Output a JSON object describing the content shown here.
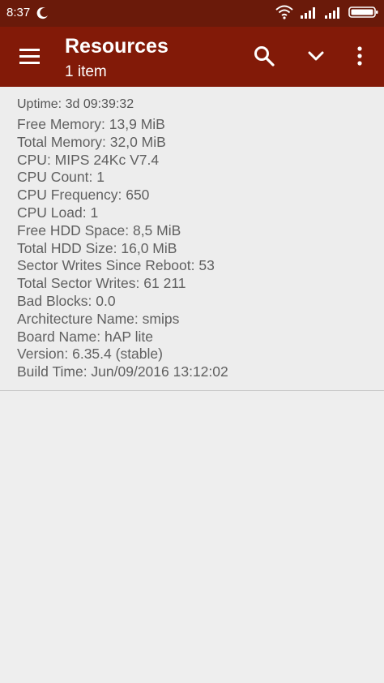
{
  "status_bar": {
    "time": "8:37",
    "app_icon": "moon-icon",
    "icons": [
      "wifi-icon",
      "signal-icon",
      "signal-icon",
      "battery-icon"
    ]
  },
  "toolbar": {
    "title": "Resources",
    "subtitle": "1 item",
    "background": "#821a08",
    "icons": [
      "menu-icon",
      "search-icon",
      "chevron-down-icon",
      "more-vertical-icon"
    ]
  },
  "resource": {
    "uptime": "Uptime: 3d 09:39:32",
    "lines": [
      "Free Memory: 13,9 MiB",
      "Total Memory: 32,0 MiB",
      "CPU: MIPS 24Kc V7.4",
      "CPU Count: 1",
      "CPU Frequency: 650",
      "CPU Load: 1",
      "Free HDD Space: 8,5 MiB",
      "Total HDD Size: 16,0 MiB",
      "Sector Writes Since Reboot: 53",
      "Total Sector Writes: 61 211",
      "Bad Blocks: 0.0",
      "Architecture Name: smips",
      "Board Name: hAP lite",
      "Version: 6.35.4 (stable)",
      "Build Time: Jun/09/2016 13:12:02"
    ]
  }
}
